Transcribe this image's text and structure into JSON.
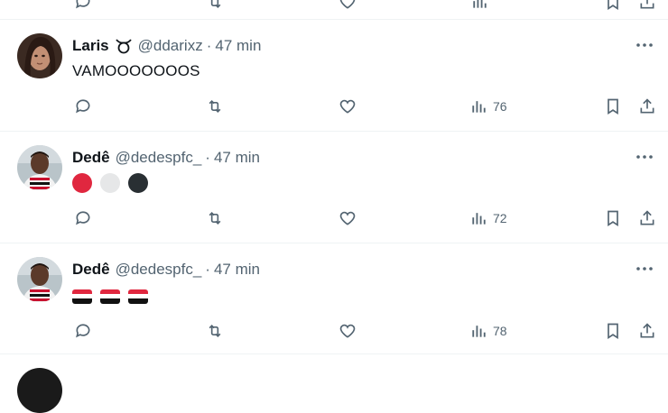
{
  "tweets": [
    {
      "name": "Laris",
      "name_emoji": "taurus-sign",
      "handle": "@ddarixz",
      "separator": "·",
      "time": "47 min",
      "text": "VAMOOOOOOOS",
      "views": "76",
      "avatar": "profile-photo-woman"
    },
    {
      "name": "Dedê",
      "handle": "@dedespfc_",
      "separator": "·",
      "time": "47 min",
      "emojis": [
        "red-circle",
        "white-circle",
        "black-circle"
      ],
      "views": "72",
      "avatar": "profile-photo-man"
    },
    {
      "name": "Dedê",
      "handle": "@dedespfc_",
      "separator": "·",
      "time": "47 min",
      "emojis": [
        "sao-paulo-flag",
        "sao-paulo-flag",
        "sao-paulo-flag"
      ],
      "views": "78",
      "avatar": "profile-photo-man"
    }
  ],
  "colors": {
    "text": "#0f1419",
    "secondary": "#536471",
    "divider": "#eff3f4",
    "red": "#e0273f",
    "white_circle": "#e6e7e8",
    "black_circle": "#292f33"
  }
}
